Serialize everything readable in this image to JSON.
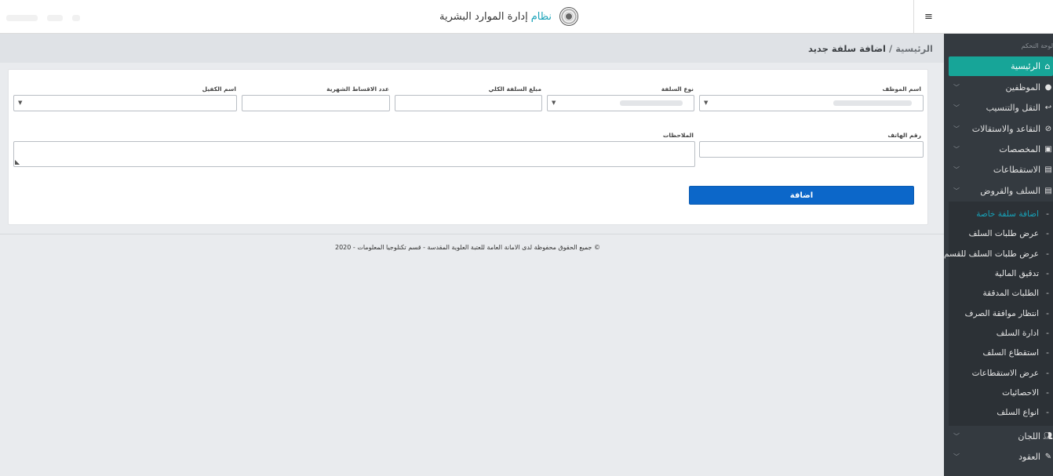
{
  "header": {
    "brand_highlight": "نظام",
    "brand_title": "إدارة الموارد البشرية",
    "menu_toggle": "≡"
  },
  "sidebar": {
    "caption": "لوحة التحكم",
    "home": {
      "label": "الرئيسية",
      "icon": "home-icon"
    },
    "items": [
      {
        "label": "الموظفين",
        "icon": "user-icon"
      },
      {
        "label": "التقل والتنسيب",
        "icon": "reply-icon"
      },
      {
        "label": "التقاعد والاستقالات",
        "icon": "user-slash-icon"
      },
      {
        "label": "المخصصات",
        "icon": "file-plus-icon"
      },
      {
        "label": "الاستقطاعات",
        "icon": "file-icon"
      },
      {
        "label": "السلف والقروض",
        "icon": "file-icon"
      }
    ],
    "submenu": [
      "اضافة سلفة خاصة",
      "عرض طلبات السلف",
      "عرض طلبات السلف للقسم",
      "تدقيق المالية",
      "الطلبات المدققة",
      "انتظار موافقة الصرف",
      "ادارة السلف",
      "استقطاع السلف",
      "عرض الاستقطاعات",
      "الاحصائيات",
      "انواع السلف"
    ],
    "bottom_items": [
      {
        "label": "اللجان",
        "icon": "users-icon"
      },
      {
        "label": "العقود",
        "icon": "file-signature-icon"
      }
    ]
  },
  "breadcrumb": {
    "home": "الرئيسية",
    "separator": "/",
    "current": "اضافة سلفة جديد"
  },
  "form": {
    "labels": {
      "employee_name": "اسم الموظف",
      "loan_type": "نوع السلفة",
      "total_amount": "مبلغ السلفة الكلي",
      "installments": "عدد الاقساط الشهرية",
      "guarantor": "اسم الكفيل",
      "phone": "رقم الهاتف",
      "notes": "الملاحظات"
    },
    "submit_label": "اضافة"
  },
  "footer": {
    "text": "© جميع الحقوق محفوظة لدى الامانة العامة للعتبة العلوية المقدسة - قسم تكنلوجيا المعلومات - 2020"
  },
  "colors": {
    "accent": "#17a598",
    "primary_button": "#0c67c9",
    "sidebar_bg": "#343a40"
  }
}
